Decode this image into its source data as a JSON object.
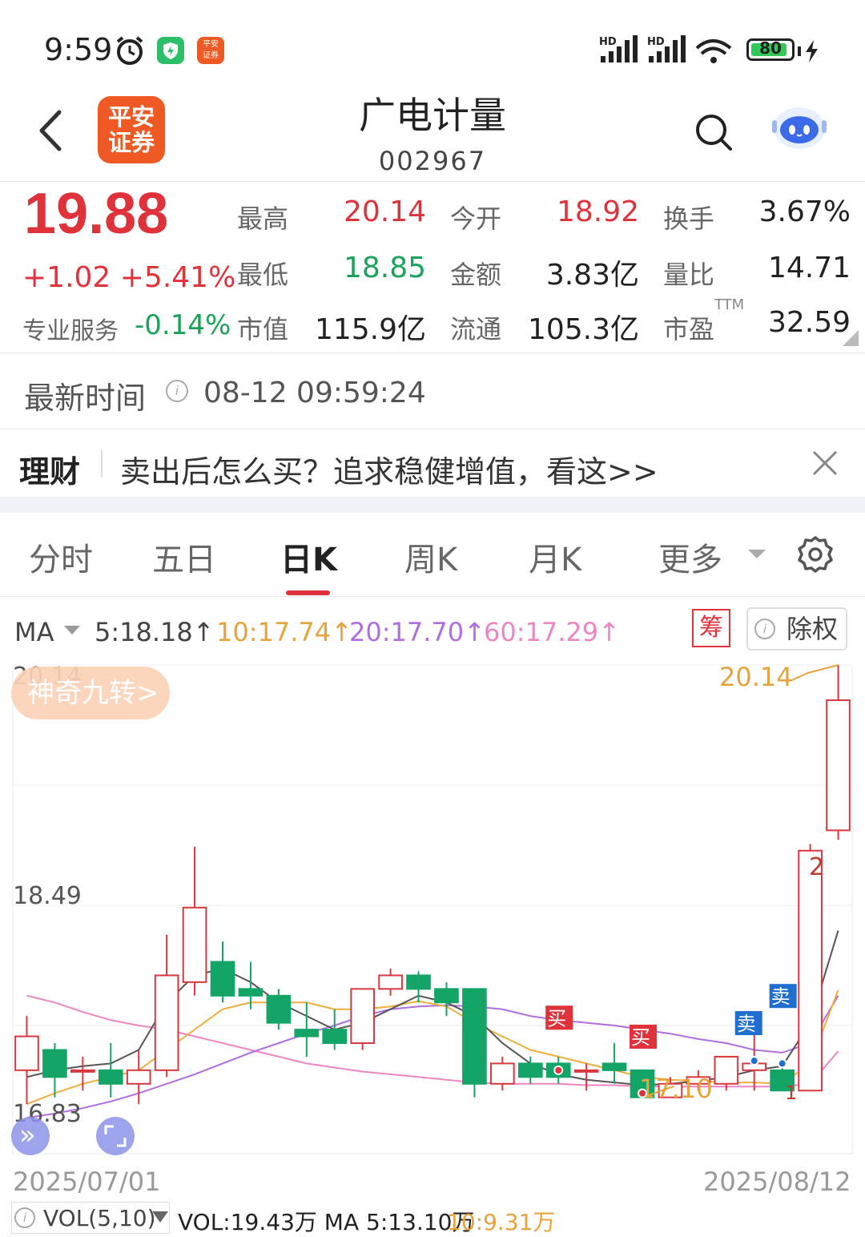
{
  "status_bar": {
    "time": "9:59",
    "battery": "80",
    "signal_1": "HD",
    "signal_2": "HD"
  },
  "header": {
    "logo_line1": "平安",
    "logo_line2": "证券",
    "stock_name": "广电计量",
    "stock_code": "002967"
  },
  "quote": {
    "price": "19.88",
    "change": "+1.02 +5.41%",
    "pro_service_label": "专业服务",
    "pro_service_value": "-0.14%",
    "high_label": "最高",
    "high": "20.14",
    "open_label": "今开",
    "open": "18.92",
    "turnover_label": "换手",
    "turnover": "3.67%",
    "low_label": "最低",
    "low": "18.85",
    "amount_label": "金额",
    "amount": "3.83亿",
    "volume_ratio_label": "量比",
    "volume_ratio": "14.71",
    "mkt_cap_label": "市值",
    "mkt_cap": "115.9亿",
    "float_label": "流通",
    "float_cap": "105.3亿",
    "pe_label": "市盈",
    "pe_tag": "TTM",
    "pe": "32.59"
  },
  "latest_time": {
    "label": "最新时间",
    "value": "08-12 09:59:24"
  },
  "finance_banner": {
    "tag": "理财",
    "text": "卖出后怎么买？追求稳健增值，看这>>"
  },
  "tabs": [
    {
      "label": "分时",
      "active": false
    },
    {
      "label": "五日",
      "active": false
    },
    {
      "label": "日K",
      "active": true
    },
    {
      "label": "周K",
      "active": false
    },
    {
      "label": "月K",
      "active": false
    },
    {
      "label": "更多",
      "active": false
    }
  ],
  "ma_bar": {
    "label": "MA",
    "ma5": "5:18.18↑",
    "ma10": "10:17.74↑",
    "ma20": "20:17.70↑",
    "ma60": "60:17.29↑",
    "chip_label": "筹",
    "exright_label": "除权"
  },
  "chart_data": {
    "type": "candlestick",
    "y_ticks": [
      "20.14",
      "18.49",
      "16.83"
    ],
    "x_labels": [
      "2025/07/01",
      "2025/08/12"
    ],
    "ylim": [
      16.83,
      20.14
    ],
    "high_marker": "20.14",
    "low_marker": "17.10",
    "promo_badge": "神奇九转>",
    "nine_turn_labels": [
      "2",
      "1"
    ],
    "signals": [
      "买",
      "买",
      "卖",
      "卖"
    ],
    "colors": {
      "up": "#d9383e",
      "down": "#12a567",
      "ma5": "#555555",
      "ma10": "#efae3c",
      "ma20": "#b06de0",
      "ma60": "#ef86c3"
    },
    "candles": [
      {
        "o": 17.15,
        "h": 17.55,
        "l": 16.9,
        "c": 17.4
      },
      {
        "o": 17.3,
        "h": 17.35,
        "l": 16.95,
        "c": 17.1
      },
      {
        "o": 17.15,
        "h": 17.25,
        "l": 17.0,
        "c": 17.15
      },
      {
        "o": 17.15,
        "h": 17.35,
        "l": 16.95,
        "c": 17.05
      },
      {
        "o": 17.05,
        "h": 17.3,
        "l": 16.9,
        "c": 17.15
      },
      {
        "o": 17.15,
        "h": 18.15,
        "l": 17.1,
        "c": 17.85
      },
      {
        "o": 17.8,
        "h": 18.8,
        "l": 17.7,
        "c": 18.35
      },
      {
        "o": 17.95,
        "h": 18.1,
        "l": 17.65,
        "c": 17.7
      },
      {
        "o": 17.75,
        "h": 17.95,
        "l": 17.6,
        "c": 17.7
      },
      {
        "o": 17.7,
        "h": 17.75,
        "l": 17.45,
        "c": 17.5
      },
      {
        "o": 17.45,
        "h": 17.65,
        "l": 17.25,
        "c": 17.4
      },
      {
        "o": 17.45,
        "h": 17.6,
        "l": 17.3,
        "c": 17.35
      },
      {
        "o": 17.35,
        "h": 17.75,
        "l": 17.3,
        "c": 17.75
      },
      {
        "o": 17.75,
        "h": 17.9,
        "l": 17.7,
        "c": 17.85
      },
      {
        "o": 17.85,
        "h": 17.88,
        "l": 17.65,
        "c": 17.75
      },
      {
        "o": 17.75,
        "h": 17.8,
        "l": 17.55,
        "c": 17.65
      },
      {
        "o": 17.75,
        "h": 17.75,
        "l": 16.95,
        "c": 17.05
      },
      {
        "o": 17.05,
        "h": 17.25,
        "l": 17.0,
        "c": 17.2
      },
      {
        "o": 17.2,
        "h": 17.25,
        "l": 17.05,
        "c": 17.1
      },
      {
        "o": 17.2,
        "h": 17.25,
        "l": 17.05,
        "c": 17.1
      },
      {
        "o": 17.15,
        "h": 17.2,
        "l": 17.0,
        "c": 17.15
      },
      {
        "o": 17.2,
        "h": 17.35,
        "l": 17.05,
        "c": 17.15
      },
      {
        "o": 17.15,
        "h": 17.15,
        "l": 16.95,
        "c": 16.95
      },
      {
        "o": 16.95,
        "h": 17.1,
        "l": 16.95,
        "c": 17.05
      },
      {
        "o": 17.05,
        "h": 17.15,
        "l": 17.0,
        "c": 17.1
      },
      {
        "o": 17.05,
        "h": 17.25,
        "l": 17.0,
        "c": 17.25
      },
      {
        "o": 17.15,
        "h": 17.45,
        "l": 17.0,
        "c": 17.2
      },
      {
        "o": 17.15,
        "h": 17.2,
        "l": 17.0,
        "c": 17.0
      },
      {
        "o": 17.0,
        "h": 18.82,
        "l": 17.0,
        "c": 18.77
      },
      {
        "o": 18.92,
        "h": 20.14,
        "l": 18.85,
        "c": 19.88
      }
    ],
    "ma5": [
      17.1,
      17.15,
      17.18,
      17.2,
      17.3,
      17.65,
      17.85,
      17.9,
      17.8,
      17.65,
      17.55,
      17.45,
      17.5,
      17.6,
      17.7,
      17.65,
      17.55,
      17.35,
      17.2,
      17.12,
      17.08,
      17.06,
      17.04,
      17.05,
      17.07,
      17.1,
      17.15,
      17.18,
      17.5,
      18.18
    ],
    "ma10": [
      16.9,
      16.98,
      17.05,
      17.1,
      17.15,
      17.3,
      17.45,
      17.6,
      17.65,
      17.65,
      17.65,
      17.6,
      17.6,
      17.62,
      17.66,
      17.62,
      17.5,
      17.4,
      17.3,
      17.25,
      17.2,
      17.15,
      17.1,
      17.08,
      17.07,
      17.06,
      17.06,
      17.05,
      17.2,
      17.74
    ],
    "ma20": [
      16.8,
      16.83,
      16.87,
      16.92,
      16.98,
      17.05,
      17.12,
      17.2,
      17.28,
      17.35,
      17.42,
      17.48,
      17.55,
      17.6,
      17.62,
      17.63,
      17.62,
      17.6,
      17.55,
      17.52,
      17.5,
      17.48,
      17.45,
      17.42,
      17.38,
      17.35,
      17.3,
      17.28,
      17.35,
      17.7
    ],
    "ma60": [
      17.7,
      17.65,
      17.58,
      17.52,
      17.48,
      17.45,
      17.4,
      17.35,
      17.3,
      17.25,
      17.2,
      17.17,
      17.14,
      17.12,
      17.1,
      17.08,
      17.06,
      17.05,
      17.05,
      17.05,
      17.04,
      17.04,
      17.03,
      17.03,
      17.03,
      17.03,
      17.03,
      17.03,
      17.05,
      17.29
    ]
  },
  "volume_bar": {
    "label": "VOL(5,10)",
    "vol_text": "VOL:19.43万 MA 5:13.10万",
    "ma10_text": "10:9.31万"
  }
}
